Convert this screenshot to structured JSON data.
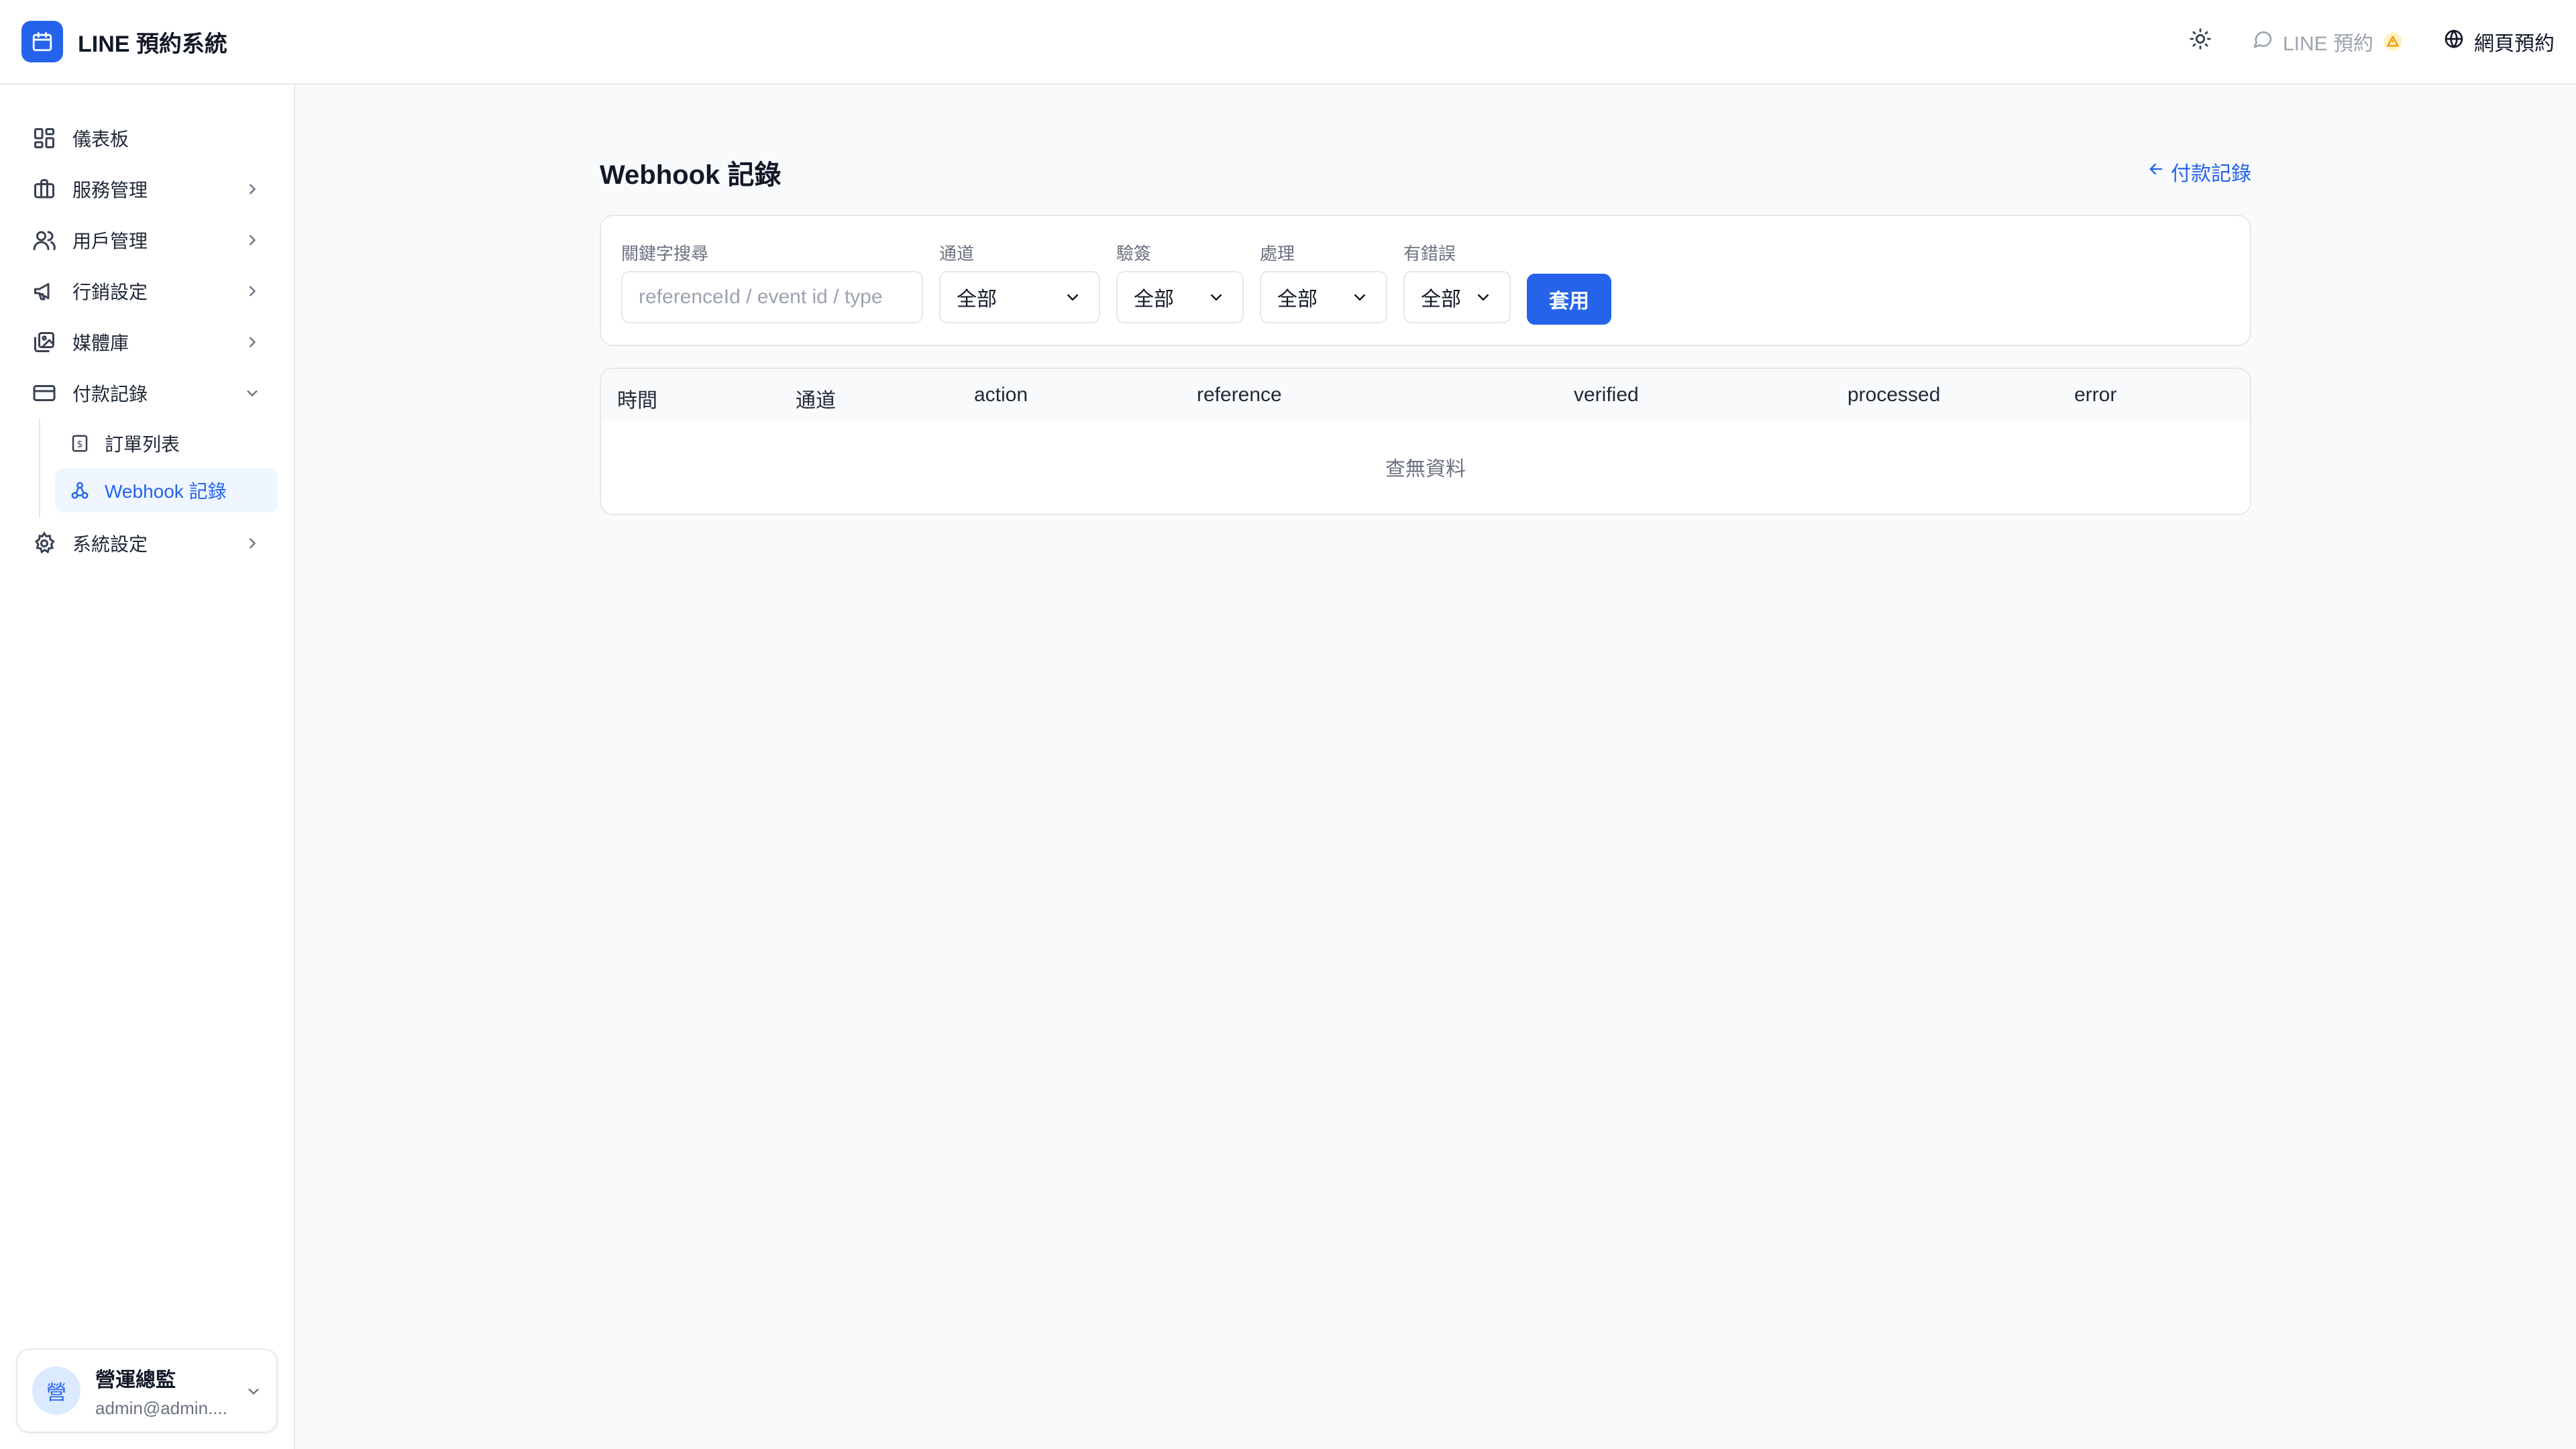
{
  "app": {
    "title": "LINE 預約系統"
  },
  "header": {
    "line_label": "LINE 預約",
    "web_label": "網頁預約"
  },
  "sidebar": {
    "items": [
      {
        "label": "儀表板"
      },
      {
        "label": "服務管理"
      },
      {
        "label": "用戶管理"
      },
      {
        "label": "行銷設定"
      },
      {
        "label": "媒體庫"
      },
      {
        "label": "付款記錄"
      },
      {
        "label": "系統設定"
      }
    ],
    "sub_items": [
      {
        "label": "訂單列表"
      },
      {
        "label": "Webhook 記錄"
      }
    ]
  },
  "user": {
    "avatar_char": "營",
    "name": "營運總監",
    "email": "admin@admin...."
  },
  "page": {
    "title": "Webhook 記錄",
    "back_label": "付款記錄"
  },
  "filters": {
    "search_label": "關鍵字搜尋",
    "search_placeholder": "referenceId / event id / type",
    "channel_label": "通道",
    "channel_value": "全部",
    "verified_label": "驗簽",
    "verified_value": "全部",
    "processed_label": "處理",
    "processed_value": "全部",
    "error_label": "有錯誤",
    "error_value": "全部",
    "apply_label": "套用"
  },
  "table": {
    "columns": [
      "時間",
      "通道",
      "action",
      "reference",
      "verified",
      "processed",
      "error"
    ],
    "empty_text": "查無資料"
  },
  "colors": {
    "accent": "#2563eb",
    "warning": "#f59e0b"
  }
}
